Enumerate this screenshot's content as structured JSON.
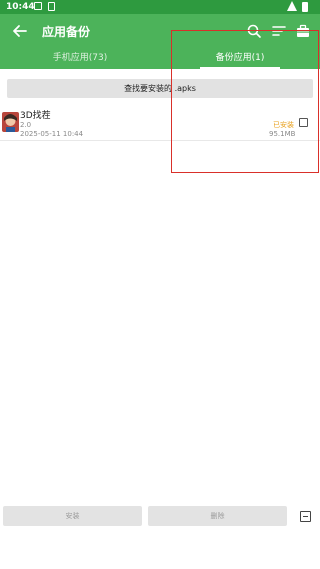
{
  "status_bar": {
    "time": "10:44"
  },
  "app_bar": {
    "title": "应用备份"
  },
  "tabs": [
    {
      "label": "手机应用(73)",
      "selected": false
    },
    {
      "label": "备份应用(1)",
      "selected": true
    }
  ],
  "search_button": {
    "label": "查找要安装的 .apks"
  },
  "apps": [
    {
      "name": "3D找茬",
      "version": "2.0",
      "date": "2025-05-11 10:44",
      "status": "已安装",
      "size": "95.1MB",
      "checked": false
    }
  ],
  "bottom": {
    "install_label": "安装",
    "delete_label": "删除"
  },
  "colors": {
    "primary": "#4cb35a",
    "status_bar": "#2e9a3f",
    "installed": "#e8a01c",
    "highlight_box": "#d9302a"
  },
  "icons": [
    "notification-icon",
    "sim-icon",
    "wifi-icon",
    "battery-icon",
    "back-arrow-icon",
    "search-icon",
    "sort-icon",
    "toolbox-icon",
    "app-icon",
    "checkbox-icon",
    "minus-square-icon"
  ]
}
